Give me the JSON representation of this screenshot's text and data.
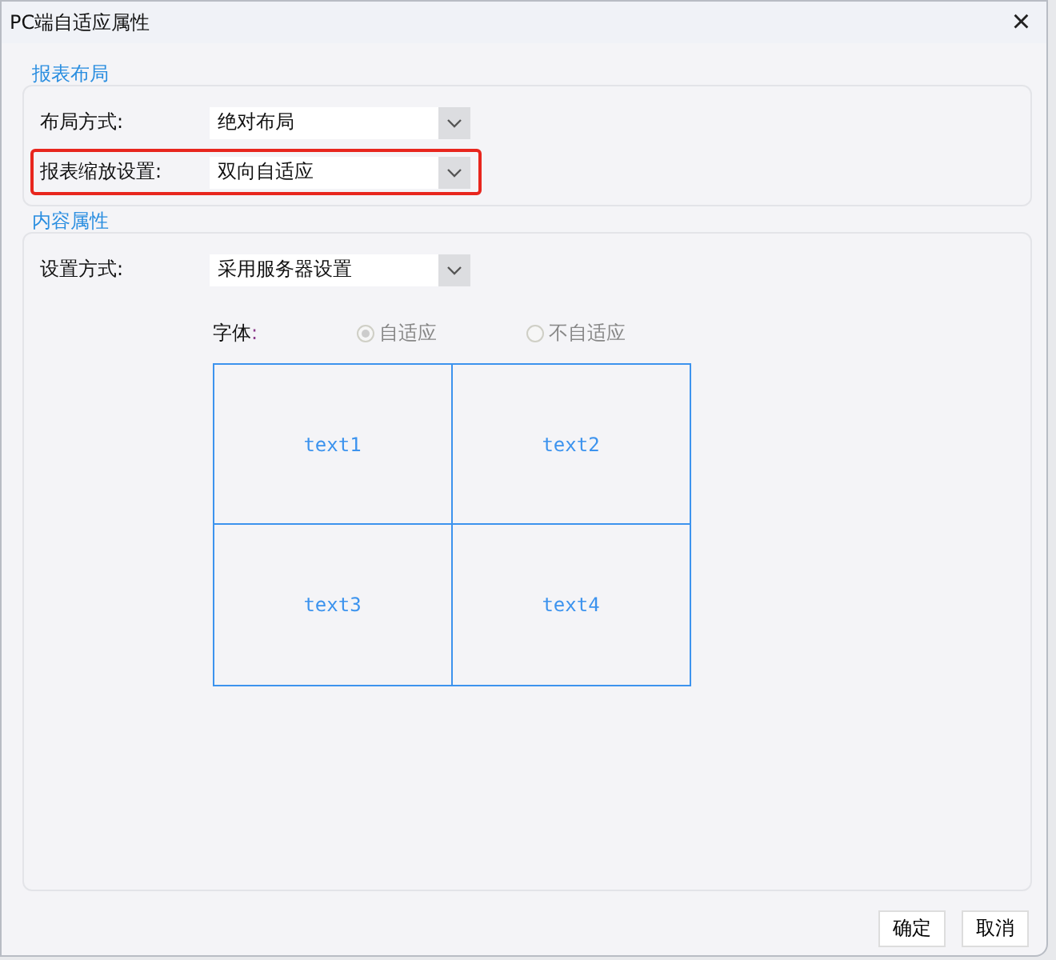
{
  "window": {
    "title": "PC端自适应属性",
    "close": "×"
  },
  "sections": [
    {
      "legend": "报表布局",
      "rows": [
        {
          "label": "布局方式:",
          "value": "绝对布局",
          "highlighted": false
        },
        {
          "label": "报表缩放设置:",
          "value": "双向自适应",
          "highlighted": true
        }
      ]
    },
    {
      "legend": "内容属性",
      "rows": [
        {
          "label": "设置方式:",
          "value": "采用服务器设置",
          "highlighted": false
        }
      ],
      "font": {
        "label": "字体",
        "colon": ":",
        "options": [
          {
            "label": "自适应",
            "selected": true,
            "disabled": true
          },
          {
            "label": "不自适应",
            "selected": false,
            "disabled": true
          }
        ]
      },
      "preview": [
        "text1",
        "text2",
        "text3",
        "text4"
      ]
    }
  ],
  "buttons": [
    "确定",
    "取消"
  ]
}
